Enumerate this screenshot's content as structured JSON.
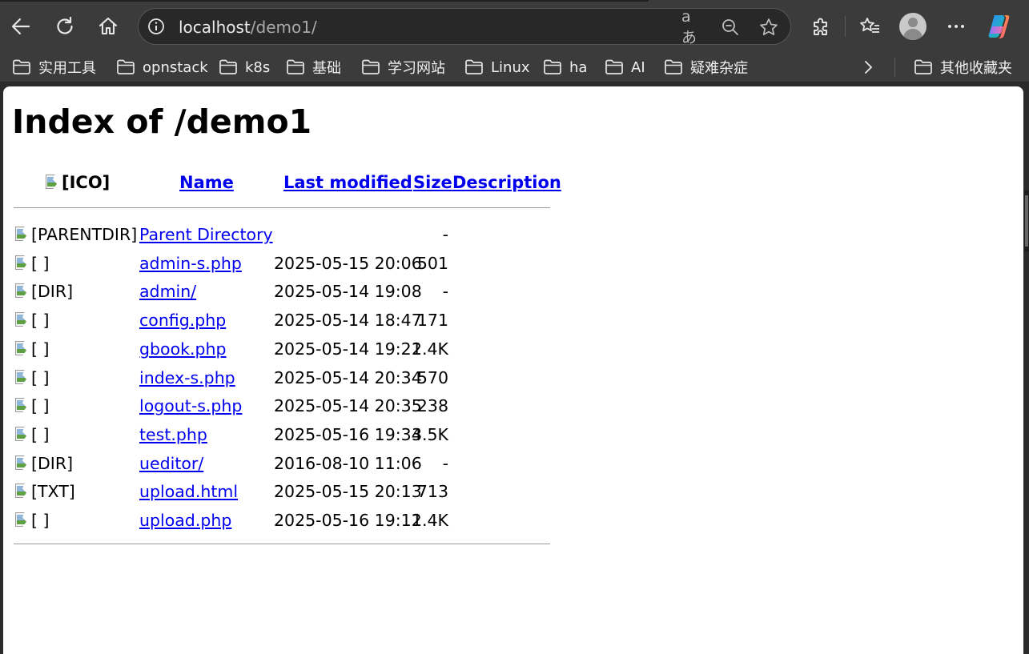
{
  "browser": {
    "url_host": "localhost",
    "url_path": "/demo1/",
    "bookmarks": [
      {
        "label": "实用工具"
      },
      {
        "label": "opnstack"
      },
      {
        "label": "k8s"
      },
      {
        "label": "基础"
      },
      {
        "label": "学习网站"
      },
      {
        "label": "Linux"
      },
      {
        "label": "ha"
      },
      {
        "label": "AI"
      },
      {
        "label": "疑难杂症"
      }
    ],
    "other_bookmarks": "其他收藏夹",
    "read_aloud_glyph": "aあ"
  },
  "page": {
    "title": "Index of /demo1",
    "headers": {
      "icon_alt": "[ICO]",
      "name": "Name",
      "last_modified": "Last modified",
      "size": "Size",
      "description": "Description"
    },
    "rows": [
      {
        "icon_alt": "[PARENTDIR]",
        "name": "Parent Directory",
        "modified": "",
        "size": "-"
      },
      {
        "icon_alt": "[ ]",
        "name": "admin-s.php",
        "modified": "2025-05-15 20:06",
        "size": "501"
      },
      {
        "icon_alt": "[DIR]",
        "name": "admin/",
        "modified": "2025-05-14 19:08",
        "size": "-"
      },
      {
        "icon_alt": "[ ]",
        "name": "config.php",
        "modified": "2025-05-14 18:47",
        "size": "171"
      },
      {
        "icon_alt": "[ ]",
        "name": "gbook.php",
        "modified": "2025-05-14 19:21",
        "size": "2.4K"
      },
      {
        "icon_alt": "[ ]",
        "name": "index-s.php",
        "modified": "2025-05-14 20:34",
        "size": "570"
      },
      {
        "icon_alt": "[ ]",
        "name": "logout-s.php",
        "modified": "2025-05-14 20:35",
        "size": "238"
      },
      {
        "icon_alt": "[ ]",
        "name": "test.php",
        "modified": "2025-05-16 19:34",
        "size": "3.5K"
      },
      {
        "icon_alt": "[DIR]",
        "name": "ueditor/",
        "modified": "2016-08-10 11:06",
        "size": "-"
      },
      {
        "icon_alt": "[TXT]",
        "name": "upload.html",
        "modified": "2025-05-15 20:13",
        "size": "713"
      },
      {
        "icon_alt": "[ ]",
        "name": "upload.php",
        "modified": "2025-05-16 19:12",
        "size": "1.4K"
      }
    ]
  },
  "colors": {
    "link": "#0000ee",
    "toolbar_bg": "#3b3b3b",
    "page_bg": "#ffffff"
  }
}
